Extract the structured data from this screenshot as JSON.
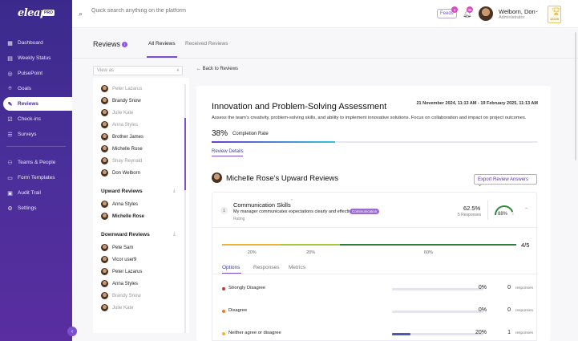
{
  "brand": {
    "logo": "eleap",
    "badge": "PRO"
  },
  "sidebar": {
    "items": [
      {
        "label": "Dashboard",
        "icon": "dashboard-icon"
      },
      {
        "label": "Weekly Status",
        "icon": "calendar-icon"
      },
      {
        "label": "PulsePoint",
        "icon": "pulse-icon"
      },
      {
        "label": "Goals",
        "icon": "target-icon"
      },
      {
        "label": "Reviews",
        "icon": "reviews-icon"
      },
      {
        "label": "Check-ins",
        "icon": "checkin-icon"
      },
      {
        "label": "Surveys",
        "icon": "survey-icon"
      },
      {
        "label": "Teams & People",
        "icon": "team-icon"
      },
      {
        "label": "Form Templates",
        "icon": "form-icon"
      },
      {
        "label": "Audit Trail",
        "icon": "audit-icon"
      },
      {
        "label": "Settings",
        "icon": "settings-icon"
      }
    ],
    "active_index": 4
  },
  "topbar": {
    "search_placeholder": "Quick search anything on the platform",
    "feeds_label": "Feeds",
    "feeds_badge": "4",
    "bell_badge": "36",
    "user_name": "Welborn, Don",
    "user_role": "Administrator",
    "points": "12220"
  },
  "page": {
    "title": "Reviews",
    "info": "i",
    "tabs": [
      "All Reviews",
      "Received Reviews"
    ],
    "active_tab": 0,
    "view_as_placeholder": "View as",
    "back_label": "Back to Reviews"
  },
  "people": {
    "top": [
      {
        "name": "Peter Lazarus",
        "muted": true
      },
      {
        "name": "Brandy Snow",
        "muted": false
      },
      {
        "name": "Julie Kate",
        "muted": true
      },
      {
        "name": "Anna Styles",
        "muted": true
      },
      {
        "name": "Brother James",
        "muted": false
      },
      {
        "name": "Michelle Rose",
        "muted": false
      },
      {
        "name": "Shay Reynald",
        "muted": true
      },
      {
        "name": "Don Welborn",
        "muted": false
      }
    ],
    "upward_heading": "Upward Reviews",
    "upward": [
      {
        "name": "Anna Styles",
        "muted": false,
        "bold": false
      },
      {
        "name": "Michelle Rose",
        "muted": false,
        "bold": true
      }
    ],
    "downward_heading": "Downward Reviews",
    "downward": [
      {
        "name": "Pete Sam",
        "muted": false
      },
      {
        "name": "Vicor user9",
        "muted": false
      },
      {
        "name": "Peter Lazarus",
        "muted": false
      },
      {
        "name": "Anna Styles",
        "muted": false
      },
      {
        "name": "Brandy Snow",
        "muted": true
      },
      {
        "name": "Julie Kate",
        "muted": true
      }
    ]
  },
  "review": {
    "title": "Innovation and Problem-Solving Assessment",
    "dates": "21 November 2024, 11:13 AM - 19 February 2025, 11:13 AM",
    "description": "Assess the team's creativity, problem-solving skills, and ability to implement innovative solutions. Focus on collaboration and impact on project outcomes.",
    "completion_pct": "38%",
    "completion_value": 38,
    "completion_label": "Completion Rate",
    "details_label": "Review Details",
    "upward_title": "Michelle Rose's Upward Reviews",
    "export_label": "Export Review Answers"
  },
  "question": {
    "number": "1",
    "title": "Communication Skills",
    "required_mark": "*",
    "text": "My manager communicates expectations clearly and effectively",
    "tag": "Communication",
    "type": "Rating",
    "score_pct": "62.5%",
    "responses": "5 Responses",
    "gauge_label": "88%",
    "gauge_value": 88,
    "segments": [
      {
        "pct": 20,
        "label": "20%",
        "color": "#f2b233"
      },
      {
        "pct": 20,
        "label": "20%",
        "color": "#a6c93a"
      },
      {
        "pct": 60,
        "label": "60%",
        "color": "#2f7d3a"
      }
    ],
    "total": "4/5",
    "sub_tabs": [
      "Options",
      "Responses",
      "Metrics"
    ],
    "active_sub_tab": 0,
    "options": [
      {
        "label": "Strongly Disagree",
        "pct_label": "0%",
        "pct": 0,
        "count": "0",
        "resp": "responses",
        "color": "#c0392b"
      },
      {
        "label": "Disagree",
        "pct_label": "0%",
        "pct": 0,
        "count": "0",
        "resp": "responses",
        "color": "#e67e22"
      },
      {
        "label": "Neither agree or disagree",
        "pct_label": "20%",
        "pct": 20,
        "count": "1",
        "resp": "responses",
        "color": "#f2b233"
      }
    ]
  }
}
